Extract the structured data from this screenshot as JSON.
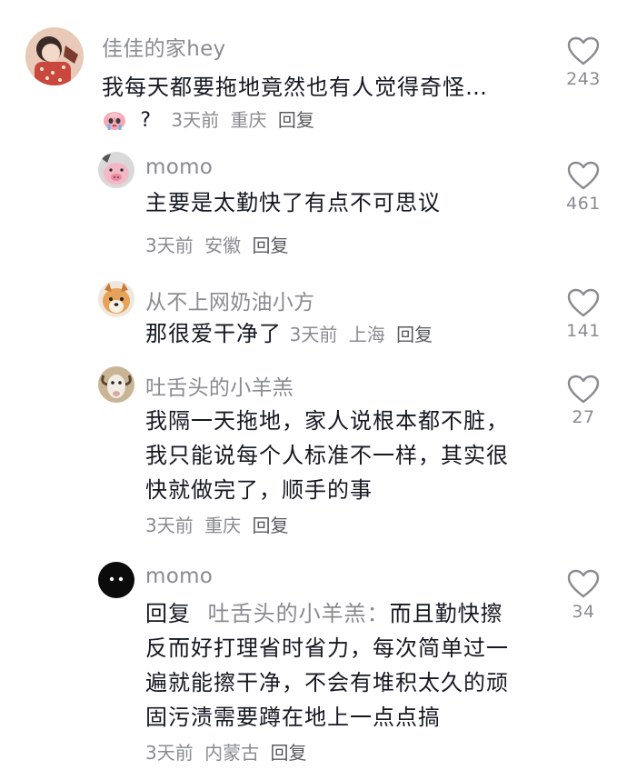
{
  "comments": [
    {
      "username": "佳佳的家hey",
      "text": "我每天都要拖地竟然也有人觉得奇怪…",
      "suffix": "?",
      "time": "3天前",
      "location": "重庆",
      "reply_label": "回复",
      "likes": "243",
      "avatar_icon": "girl-avatar"
    },
    {
      "username": "momo",
      "text": "主要是太勤快了有点不可思议",
      "time": "3天前",
      "location": "安徽",
      "reply_label": "回复",
      "likes": "461",
      "avatar_icon": "pig-avatar"
    },
    {
      "username": "从不上网奶油小方",
      "text": "那很爱干净了",
      "time": "3天前",
      "location": "上海",
      "reply_label": "回复",
      "likes": "141",
      "avatar_icon": "dog-avatar"
    },
    {
      "username": "吐舌头的小羊羔",
      "text_lines": [
        "我隔一天拖地，家人说根本都不脏，",
        "我只能说每个人标准不一样，其实很",
        "快就做完了，顺手的事"
      ],
      "time": "3天前",
      "location": "重庆",
      "reply_label": "回复",
      "likes": "27",
      "avatar_icon": "goat-avatar"
    },
    {
      "username": "momo",
      "reply_prefix": "回复",
      "reply_target": "吐舌头的小羊羔：",
      "text_lines": [
        "而且勤快擦",
        "反而好打理省时省力，每次简单过一",
        "遍就能擦干净，不会有堆积太久的顽",
        "固污渍需要蹲在地上一点点搞"
      ],
      "time": "3天前",
      "location": "内蒙古",
      "reply_label": "回复",
      "likes": "34",
      "avatar_icon": "black-blob-avatar"
    }
  ],
  "colors": {
    "text": "#161823",
    "secondary": "#8a8b91",
    "heart_outline": "#8a8b91"
  }
}
